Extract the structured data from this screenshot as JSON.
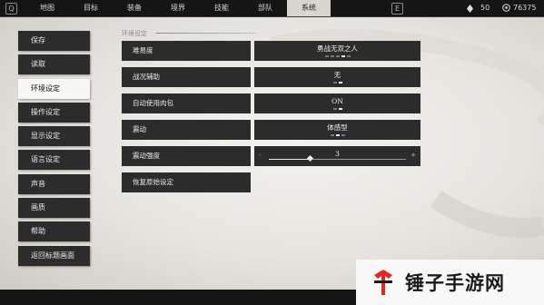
{
  "top_nav": {
    "left_key": "Q",
    "right_key": "E",
    "tabs": [
      {
        "label": "地图"
      },
      {
        "label": "目标"
      },
      {
        "label": "装备"
      },
      {
        "label": "境界"
      },
      {
        "label": "技能"
      },
      {
        "label": "部队"
      },
      {
        "label": "系统",
        "active": true
      }
    ],
    "currency_1": "50",
    "currency_2": "76375"
  },
  "side_menu": {
    "items": [
      {
        "label": "保存"
      },
      {
        "label": "读取"
      },
      {
        "label": "环境设定",
        "active": true
      },
      {
        "label": "操作设定"
      },
      {
        "label": "显示设定"
      },
      {
        "label": "语言设定"
      },
      {
        "label": "声音"
      },
      {
        "label": "画质"
      },
      {
        "label": "帮助"
      },
      {
        "label": "返回标题画面"
      }
    ]
  },
  "settings": {
    "section_title": "环境设定",
    "rows": [
      {
        "label": "难易度",
        "value": "勇战无双之人",
        "dots": [
          false,
          false,
          false,
          true,
          false
        ]
      },
      {
        "label": "战况辅助",
        "value": "无",
        "dots": [
          false,
          true
        ]
      },
      {
        "label": "自动使用肉包",
        "value": "ON",
        "dots": [
          false,
          true
        ]
      },
      {
        "label": "震动",
        "value": "体感型",
        "dots": [
          false,
          true,
          false
        ]
      },
      {
        "label": "震动强度",
        "value": "3",
        "slider_level": 0.3,
        "minus": "-",
        "plus": "+"
      }
    ],
    "reset_label": "恢复原始设定"
  },
  "watermark": {
    "text": "锤子手游网",
    "colors": {
      "red": "#e8251f",
      "dark": "#1a1a1a"
    }
  }
}
